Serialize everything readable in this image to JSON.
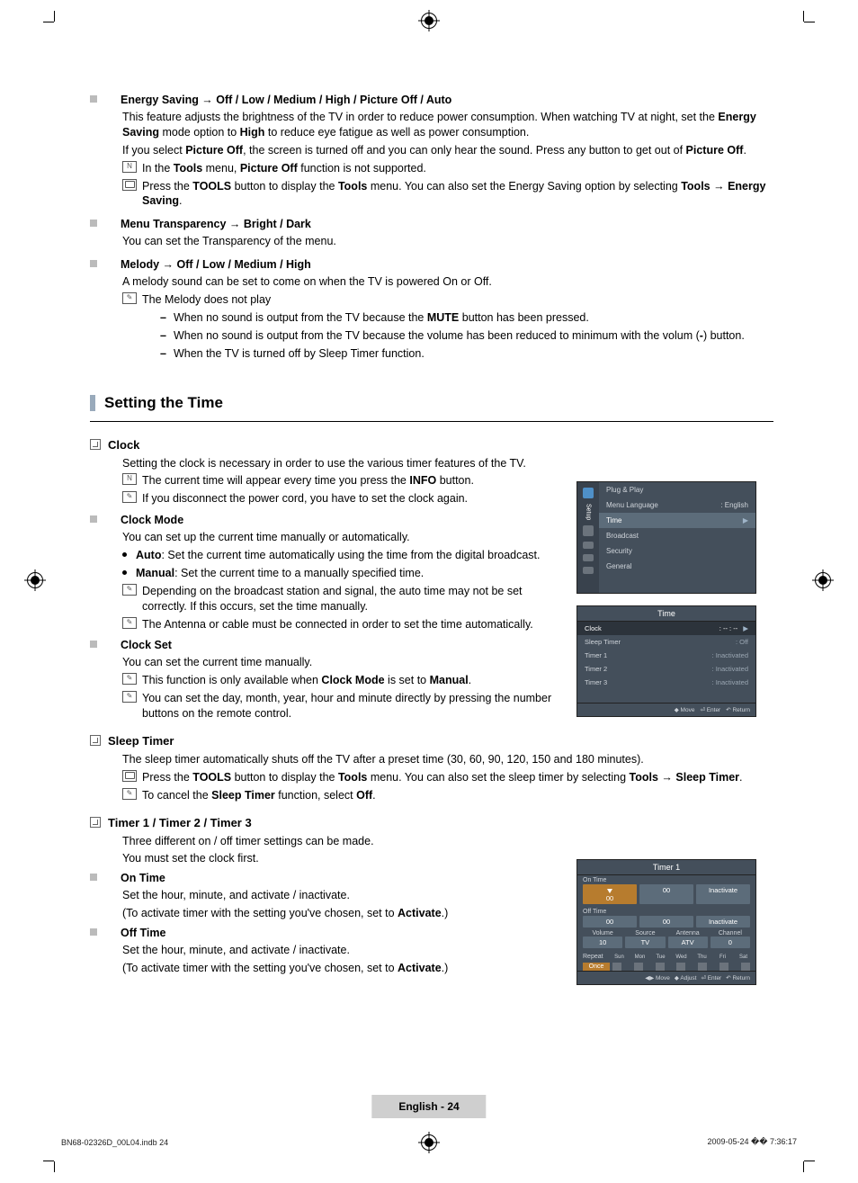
{
  "energy_saving": {
    "heading": "Energy Saving → Off / Low / Medium / High / Picture Off / Auto",
    "p1_a": "This feature adjusts the brightness of the TV in order to reduce power consumption. When watching TV at night, set the ",
    "p1_b": "Energy Saving",
    "p1_c": " mode option to ",
    "p1_d": "High",
    "p1_e": " to reduce eye fatigue as well as power consumption.",
    "p2_a": "If you select ",
    "p2_b": "Picture Off",
    "p2_c": ", the screen is turned off and you can only hear the sound. Press any button to get out of ",
    "p2_d": "Picture Off",
    "p2_e": ".",
    "n1_a": "In the ",
    "n1_b": "Tools",
    "n1_c": " menu, ",
    "n1_d": "Picture Off",
    "n1_e": " function is not supported.",
    "n2_a": "Press the ",
    "n2_b": "TOOLS",
    "n2_c": " button to display the ",
    "n2_d": "Tools",
    "n2_e": " menu. You can also set the Energy Saving option by selecting ",
    "n2_f": "Tools → Energy Saving",
    "n2_g": "."
  },
  "menu_transparency": {
    "heading": "Menu Transparency → Bright / Dark",
    "p1": "You can set the Transparency of the menu."
  },
  "melody": {
    "heading": "Melody → Off / Low / Medium / High",
    "p1": "A melody sound can be set to come on when the TV is powered On or Off.",
    "note_head": "The Melody does not play",
    "d1_a": "When no sound is output from the TV because the ",
    "d1_b": "MUTE",
    "d1_c": " button has been pressed.",
    "d2_a": "When no sound is output from the TV because the volume has been reduced to minimum with the volum (",
    "d2_b": "-",
    "d2_c": ") button.",
    "d3": "When the TV is turned off by Sleep Timer function."
  },
  "setting_time": {
    "title": "Setting the Time",
    "clock": {
      "heading": "Clock",
      "p1": "Setting the clock is necessary in order to use the various timer features of the TV.",
      "n1_a": "The current time will appear every time you press the ",
      "n1_b": "INFO",
      "n1_c": " button.",
      "n2": "If you disconnect the power cord, you have to set the clock again."
    },
    "clock_mode": {
      "heading": "Clock Mode",
      "p1": "You can set up the current time manually or automatically.",
      "b1_a": "Auto",
      "b1_b": ": Set the current time automatically using the time from the digital broadcast.",
      "b2_a": "Manual",
      "b2_b": ": Set the current time to a manually specified time.",
      "n1": "Depending on the broadcast station and signal, the auto time may not be set correctly. If this occurs, set the time manually.",
      "n2": "The Antenna or cable must be connected in order to set the time automatically."
    },
    "clock_set": {
      "heading": "Clock Set",
      "p1": "You can set the current time manually.",
      "n1_a": "This function is only available when ",
      "n1_b": "Clock Mode",
      "n1_c": " is set to ",
      "n1_d": "Manual",
      "n1_e": ".",
      "n2": "You can set the day, month, year, hour and minute directly by pressing the number buttons on the remote control."
    },
    "sleep_timer": {
      "heading": "Sleep Timer",
      "p1": "The sleep timer automatically shuts off the TV after a preset time (30, 60, 90, 120, 150 and 180 minutes).",
      "n1_a": "Press the ",
      "n1_b": "TOOLS",
      "n1_c": " button to display the ",
      "n1_d": "Tools",
      "n1_e": " menu. You can also set the sleep timer by selecting ",
      "n1_f": "Tools → Sleep Timer",
      "n1_g": ".",
      "n2_a": "To cancel the ",
      "n2_b": "Sleep Timer",
      "n2_c": " function, select ",
      "n2_d": "Off",
      "n2_e": "."
    },
    "timers": {
      "heading": "Timer 1 / Timer 2 / Timer 3",
      "p1": "Three different on / off timer settings can be made.",
      "p2": "You must set the clock first.",
      "on_time": {
        "heading": "On Time",
        "p1": "Set the hour, minute, and activate / inactivate.",
        "p2_a": "(To activate timer with the setting you've chosen, set to ",
        "p2_b": "Activate",
        "p2_c": ".)"
      },
      "off_time": {
        "heading": "Off Time",
        "p1": "Set the hour, minute, and activate / inactivate.",
        "p2_a": "(To activate timer with the setting you've chosen, set to ",
        "p2_b": "Activate",
        "p2_c": ".)"
      }
    }
  },
  "osd1": {
    "setup": "Setup",
    "items": [
      {
        "label": "Plug & Play"
      },
      {
        "label": "Menu Language",
        "val": ": English"
      },
      {
        "label": "Time",
        "hl": true,
        "arrow": "▶"
      },
      {
        "label": "Broadcast"
      },
      {
        "label": "Security"
      },
      {
        "label": "General"
      }
    ]
  },
  "osd2": {
    "title": "Time",
    "rows": [
      {
        "label": "Clock",
        "val": ": -- : --",
        "hl": true,
        "arrow": "▶"
      },
      {
        "label": "Sleep Timer",
        "val": ": Off"
      },
      {
        "label": "Timer 1",
        "val": ": Inactivated"
      },
      {
        "label": "Timer 2",
        "val": ": Inactivated"
      },
      {
        "label": "Timer 3",
        "val": ": Inactivated"
      }
    ],
    "footer": {
      "move": "◆ Move",
      "enter": "⏎ Enter",
      "return": "↶ Return"
    }
  },
  "osd3": {
    "title": "Timer 1",
    "on_time": {
      "label": "On Time",
      "h": "00",
      "m": "00",
      "state": "Inactivate"
    },
    "off_time": {
      "label": "Off Time",
      "h": "00",
      "m": "00",
      "state": "Inactivate"
    },
    "row2_labels": {
      "volume": "Volume",
      "source": "Source",
      "antenna": "Antenna",
      "channel": "Channel"
    },
    "row2_vals": {
      "volume": "10",
      "source": "TV",
      "antenna": "ATV",
      "channel": "0"
    },
    "repeat": {
      "label": "Repeat",
      "days": [
        "Sun",
        "Mon",
        "Tue",
        "Wed",
        "Thu",
        "Fri",
        "Sat"
      ],
      "once": "Once"
    },
    "footer": {
      "move": "◀▶ Move",
      "adjust": "◆ Adjust",
      "enter": "⏎ Enter",
      "return": "↶ Return"
    }
  },
  "page_footer": "English - 24",
  "indb": "BN68-02326D_00L04.indb   24",
  "print_date": "2009-05-24   �� 7:36:17",
  "note_icon_n": "N",
  "note_icon_p": "✎"
}
